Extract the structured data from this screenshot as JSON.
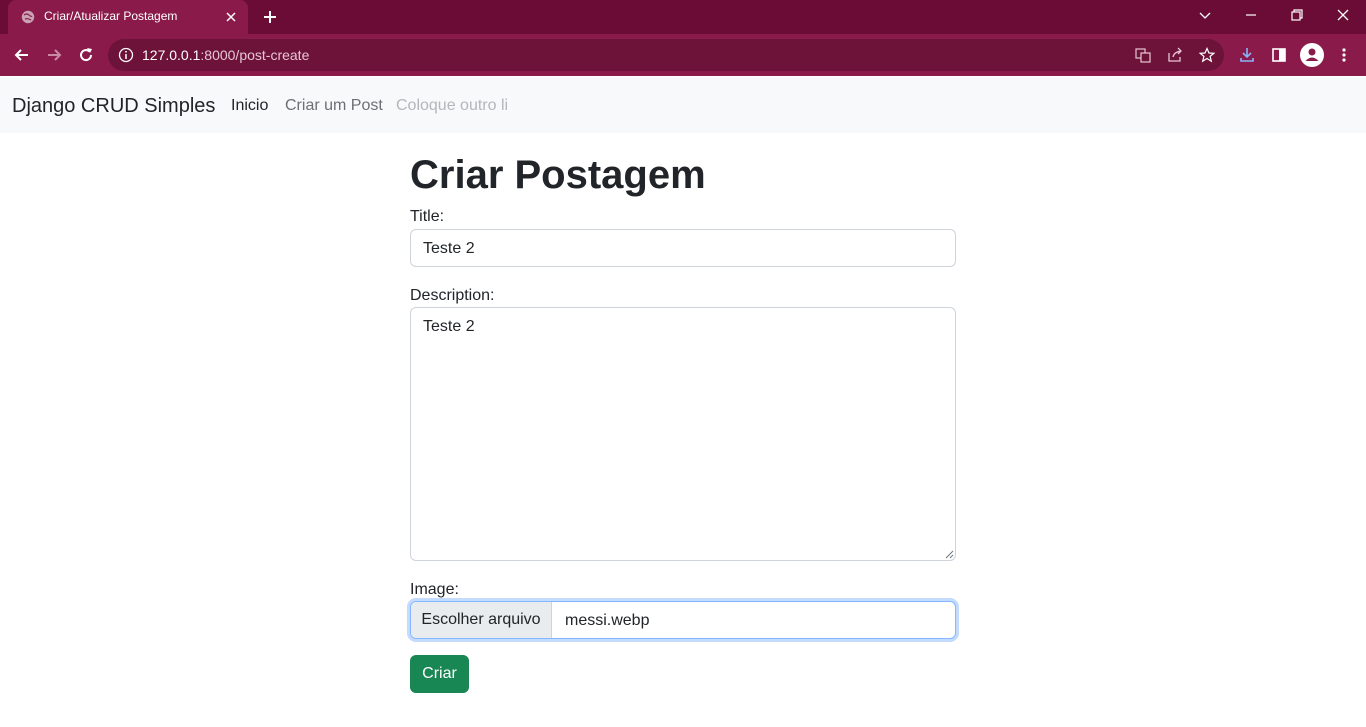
{
  "browser": {
    "tab_title": "Criar/Atualizar Postagem",
    "url_host": "127.0.0.1",
    "url_rest": ":8000/post-create"
  },
  "navbar": {
    "brand": "Django CRUD Simples",
    "links": [
      {
        "label": "Inicio",
        "state": "active"
      },
      {
        "label": "Criar um Post",
        "state": "normal"
      },
      {
        "label": "Coloque outro li",
        "state": "disabled"
      }
    ]
  },
  "form": {
    "heading": "Criar Postagem",
    "title_label": "Title:",
    "title_value": "Teste 2",
    "description_label": "Description:",
    "description_value": "Teste 2",
    "image_label": "Image:",
    "file_button_label": "Escolher arquivo",
    "file_name": "messi.webp",
    "submit_label": "Criar"
  },
  "colors": {
    "tab_strip": "#6a0c36",
    "toolbar": "#8a1a4a",
    "submit_button": "#198754",
    "navbar_bg": "#f8f9fa"
  }
}
